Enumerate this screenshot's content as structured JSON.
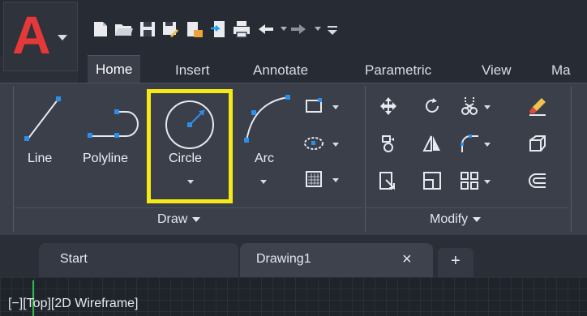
{
  "app": {
    "logo_letter": "A",
    "brand_color": "#e23a3a"
  },
  "quick_access": {
    "icons": [
      "new-icon",
      "open-icon",
      "save-icon",
      "save-as-icon",
      "open-from-web-icon",
      "save-to-web-icon",
      "plot-icon",
      "undo-icon",
      "redo-icon",
      "customize-icon"
    ]
  },
  "ribbon_tabs": [
    {
      "label": "Home",
      "active": true
    },
    {
      "label": "Insert"
    },
    {
      "label": "Annotate"
    },
    {
      "label": "Parametric"
    },
    {
      "label": "View"
    },
    {
      "label": "Ma"
    }
  ],
  "draw_panel": {
    "title": "Draw",
    "tools": [
      {
        "label": "Line",
        "icon": "line-icon"
      },
      {
        "label": "Polyline",
        "icon": "polyline-icon"
      },
      {
        "label": "Circle",
        "icon": "circle-icon",
        "highlighted": true,
        "highlight_color": "#f5ea18"
      },
      {
        "label": "Arc",
        "icon": "arc-icon"
      }
    ],
    "small_tools": [
      "rectangle-icon",
      "ellipse-icon",
      "hatch-icon"
    ]
  },
  "modify_panel": {
    "title": "Modify",
    "small_tools": [
      "move-icon",
      "rotate-icon",
      "trim-icon",
      "erase-icon",
      "copy-icon",
      "mirror-icon",
      "fillet-icon",
      "explode-icon",
      "stretch-icon",
      "scale-icon",
      "array-icon",
      "offset-icon"
    ]
  },
  "doc_tabs": [
    {
      "label": "Start"
    },
    {
      "label": "Drawing1",
      "active": true,
      "close": "×"
    },
    {
      "label": "+"
    }
  ],
  "viewport": {
    "label": "[−][Top][2D Wireframe]"
  }
}
